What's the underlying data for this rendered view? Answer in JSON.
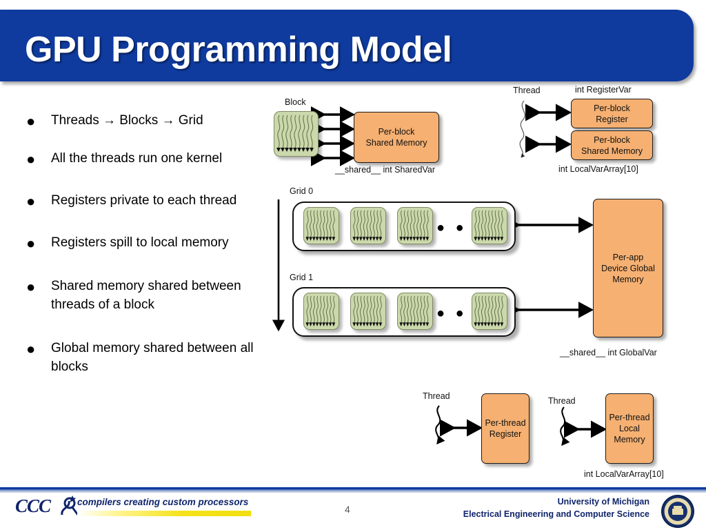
{
  "slide": {
    "title": "GPU Programming Model",
    "page_number": "4",
    "accent_blue": "#0f3a9e",
    "memory_orange": "#f5b072",
    "block_green": "#cbd8ab"
  },
  "bullets": [
    {
      "text": "Threads → Blocks → Grid"
    },
    {
      "text": "All the threads run one kernel"
    },
    {
      "text": "Registers private to each thread"
    },
    {
      "text": "Registers spill to local memory"
    },
    {
      "text": "Shared memory shared between threads of a block"
    },
    {
      "text": "Global memory shared between all blocks"
    }
  ],
  "diagram_block_shared": {
    "block_label": "Block",
    "memory_box": "Per-block\nShared Memory",
    "memory_box_line1": "Per-block",
    "memory_box_line2": "Shared Memory",
    "caption": "__shared__ int SharedVar",
    "arrow_count": 4
  },
  "diagram_thread_register": {
    "thread_label": "Thread",
    "top_caption": "int RegisterVar",
    "box1_line1": "Per-block",
    "box1_line2": "Register",
    "box2_line1": "Per-block",
    "box2_line2": "Shared Memory",
    "bottom_caption": "int LocalVarArray[10]"
  },
  "diagram_grids": {
    "grid0_label": "Grid 0",
    "grid1_label": "Grid 1",
    "blocks_per_grid_shown": 4,
    "ellipsis": "● ● ●",
    "global_memory_line1": "Per-app",
    "global_memory_line2": "Device Global",
    "global_memory_line3": "Memory",
    "global_caption": "__shared__ int GlobalVar"
  },
  "diagram_per_thread_register": {
    "thread_label": "Thread",
    "box_line1": "Per-thread",
    "box_line2": "Register"
  },
  "diagram_per_thread_local": {
    "thread_label": "Thread",
    "box_line1": "Per-thread",
    "box_line2": "Local",
    "box_line3": "Memory",
    "caption": "int LocalVarArray[10]"
  },
  "footer": {
    "logo_text": "CCC",
    "tagline": "compilers creating custom processors",
    "university_line1": "University of Michigan",
    "university_line2": "Electrical Engineering and Computer Science"
  }
}
